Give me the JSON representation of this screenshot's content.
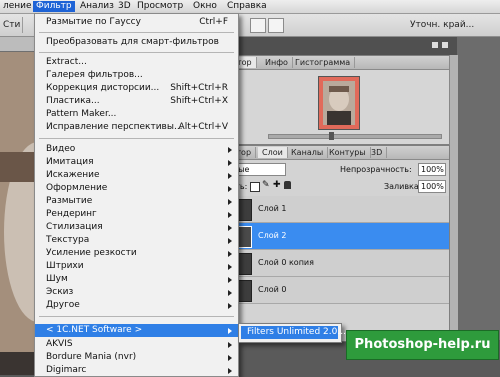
{
  "menubar": {
    "items": [
      {
        "label": "ление"
      },
      {
        "label": "Фильтр"
      },
      {
        "label": "Анализ"
      },
      {
        "label": "3D"
      },
      {
        "label": "Просмотр"
      },
      {
        "label": "Окно"
      },
      {
        "label": "Справка"
      }
    ],
    "active_index": 1
  },
  "optionsbar": {
    "left_label": "Сти",
    "right_label": "Уточн. край..."
  },
  "filter_menu": {
    "items": [
      {
        "label": "Размытие по Гауссу",
        "shortcut": "Ctrl+F"
      },
      {
        "label": "Преобразовать для смарт-фильтров"
      },
      {
        "label": "Extract..."
      },
      {
        "label": "Галерея фильтров..."
      },
      {
        "label": "Коррекция дисторсии...",
        "shortcut": "Shift+Ctrl+R"
      },
      {
        "label": "Пластика...",
        "shortcut": "Shift+Ctrl+X"
      },
      {
        "label": "Pattern Maker..."
      },
      {
        "label": "Исправление перспективы...",
        "shortcut": "Alt+Ctrl+V"
      },
      {
        "label": "Видео"
      },
      {
        "label": "Имитация"
      },
      {
        "label": "Искажение"
      },
      {
        "label": "Оформление"
      },
      {
        "label": "Размытие"
      },
      {
        "label": "Рендеринг"
      },
      {
        "label": "Стилизация"
      },
      {
        "label": "Текстура"
      },
      {
        "label": "Усиление резкости"
      },
      {
        "label": "Штрихи"
      },
      {
        "label": "Шум"
      },
      {
        "label": "Эскиз"
      },
      {
        "label": "Другое"
      },
      {
        "label": "< 1C.NET Software >"
      },
      {
        "label": "AKVIS"
      },
      {
        "label": "Bordure Mania (nvr)"
      },
      {
        "label": "Digimarc"
      }
    ]
  },
  "submenu": {
    "item": "Filters Unlimited 2.0..."
  },
  "navigator_panel": {
    "tabs": [
      {
        "label": "атор"
      },
      {
        "label": "Инфо"
      },
      {
        "label": "Гистограмма"
      }
    ]
  },
  "layers_panel": {
    "tabs": [
      {
        "label": "стор"
      },
      {
        "label": "Слои"
      },
      {
        "label": "Каналы"
      },
      {
        "label": "Контуры"
      },
      {
        "label": "3D"
      }
    ],
    "blend_mode": "ные",
    "opacity_label": "Непрозрачность:",
    "opacity_value": "100%",
    "lock_label": "ить:",
    "fill_label": "Заливка:",
    "fill_value": "100%",
    "layers": [
      {
        "name": "Слой 1",
        "selected": false
      },
      {
        "name": "Слой 2",
        "selected": true
      },
      {
        "name": "Слой 0 копия",
        "selected": false
      },
      {
        "name": "Слой 0",
        "selected": false
      }
    ]
  },
  "watermark": {
    "text": "Photoshop-help.ru"
  },
  "colors": {
    "highlight": "#2f7fe6",
    "selected_layer": "#3a8cf0",
    "watermark_bg": "#2e9b3c"
  }
}
